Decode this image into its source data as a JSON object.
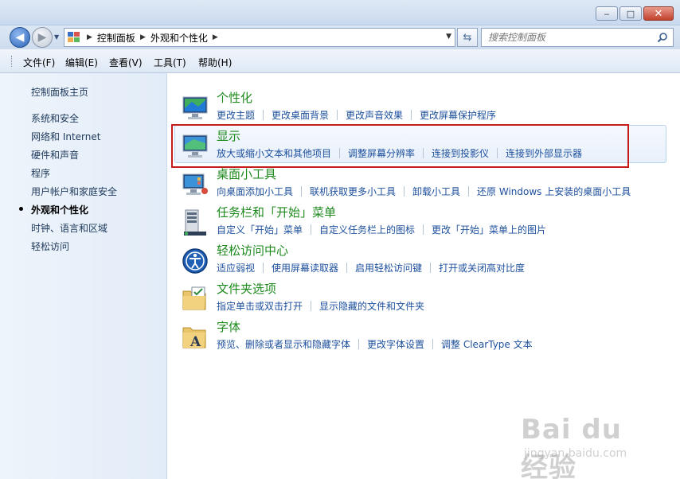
{
  "window": {
    "minimize_glyph": "‒",
    "maximize_glyph": "□",
    "close_glyph": "✕"
  },
  "navigation": {
    "breadcrumbs": [
      "控制面板",
      "外观和个性化"
    ],
    "search_placeholder": "搜索控制面板"
  },
  "menu": [
    "文件(F)",
    "编辑(E)",
    "查看(V)",
    "工具(T)",
    "帮助(H)"
  ],
  "sidebar": {
    "items": [
      {
        "label": "控制面板主页",
        "current": false
      },
      {
        "label": "系统和安全",
        "current": false
      },
      {
        "label": "网络和 Internet",
        "current": false
      },
      {
        "label": "硬件和声音",
        "current": false
      },
      {
        "label": "程序",
        "current": false
      },
      {
        "label": "用户帐户和家庭安全",
        "current": false
      },
      {
        "label": "外观和个性化",
        "current": true
      },
      {
        "label": "时钟、语言和区域",
        "current": false
      },
      {
        "label": "轻松访问",
        "current": false
      }
    ]
  },
  "categories": [
    {
      "icon": "personalization-icon",
      "title": "个性化",
      "links": [
        "更改主题",
        "更改桌面背景",
        "更改声音效果",
        "更改屏幕保护程序"
      ]
    },
    {
      "icon": "display-icon",
      "title": "显示",
      "links": [
        "放大或缩小文本和其他项目",
        "调整屏幕分辨率",
        "连接到投影仪",
        "连接到外部显示器"
      ]
    },
    {
      "icon": "desktop-gadgets-icon",
      "title": "桌面小工具",
      "links": [
        "向桌面添加小工具",
        "联机获取更多小工具",
        "卸载小工具",
        "还原 Windows 上安装的桌面小工具"
      ]
    },
    {
      "icon": "taskbar-icon",
      "title": "任务栏和「开始」菜单",
      "links": [
        "自定义「开始」菜单",
        "自定义任务栏上的图标",
        "更改「开始」菜单上的图片"
      ]
    },
    {
      "icon": "ease-of-access-icon",
      "title": "轻松访问中心",
      "links": [
        "适应弱视",
        "使用屏幕读取器",
        "启用轻松访问键",
        "打开或关闭高对比度"
      ]
    },
    {
      "icon": "folder-options-icon",
      "title": "文件夹选项",
      "links": [
        "指定单击或双击打开",
        "显示隐藏的文件和文件夹"
      ]
    },
    {
      "icon": "fonts-icon",
      "title": "字体",
      "links": [
        "预览、删除或者显示和隐藏字体",
        "更改字体设置",
        "调整 ClearType 文本"
      ]
    }
  ],
  "watermark": {
    "brand": "Bai du 经验",
    "url": "jingyan.baidu.com"
  },
  "colors": {
    "category_title": "#1e8a1e",
    "link": "#1c4f9c",
    "highlight_border": "#c51b1b"
  }
}
